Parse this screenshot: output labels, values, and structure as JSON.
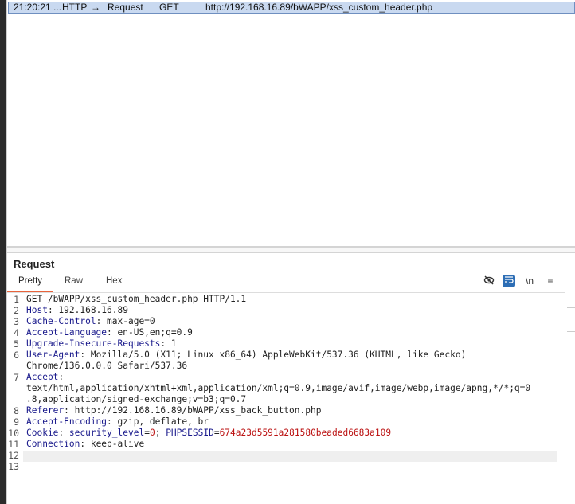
{
  "history": {
    "row": {
      "time": "21:20:21 ...",
      "tool": "HTTP",
      "direction": "→",
      "type": "Request",
      "method": "GET",
      "url": "http://192.168.16.89/bWAPP/xss_custom_header.php"
    }
  },
  "request": {
    "title": "Request",
    "tabs": [
      "Pretty",
      "Raw",
      "Hex"
    ],
    "active_tab": "Pretty",
    "toolbar": {
      "hide_icon": "eye-slash-icon",
      "wrap_icon": "wrap-lines-icon",
      "newline_label": "\\n",
      "menu_icon": "menu-icon"
    },
    "lines": [
      {
        "n": "1",
        "parts": [
          [
            "v",
            "GET /bWAPP/xss_custom_header.php HTTP/1.1"
          ]
        ]
      },
      {
        "n": "2",
        "parts": [
          [
            "k",
            "Host"
          ],
          [
            "v",
            ": 192.168.16.89"
          ]
        ]
      },
      {
        "n": "3",
        "parts": [
          [
            "k",
            "Cache-Control"
          ],
          [
            "v",
            ": max-age=0"
          ]
        ]
      },
      {
        "n": "4",
        "parts": [
          [
            "k",
            "Accept-Language"
          ],
          [
            "v",
            ": en-US,en;q=0.9"
          ]
        ]
      },
      {
        "n": "5",
        "parts": [
          [
            "k",
            "Upgrade-Insecure-Requests"
          ],
          [
            "v",
            ": 1"
          ]
        ]
      },
      {
        "n": "6",
        "parts": [
          [
            "k",
            "User-Agent"
          ],
          [
            "v",
            ": Mozilla/5.0 (X11; Linux x86_64) AppleWebKit/537.36 (KHTML, like Gecko)\nChrome/136.0.0.0 Safari/537.36"
          ]
        ]
      },
      {
        "n": "7",
        "parts": [
          [
            "k",
            "Accept"
          ],
          [
            "v",
            ":\ntext/html,application/xhtml+xml,application/xml;q=0.9,image/avif,image/webp,image/apng,*/*;q=0\n.8,application/signed-exchange;v=b3;q=0.7"
          ]
        ]
      },
      {
        "n": "8",
        "parts": [
          [
            "k",
            "Referer"
          ],
          [
            "v",
            ": http://192.168.16.89/bWAPP/xss_back_button.php"
          ]
        ]
      },
      {
        "n": "9",
        "parts": [
          [
            "k",
            "Accept-Encoding"
          ],
          [
            "v",
            ": gzip, deflate, br"
          ]
        ]
      },
      {
        "n": "10",
        "parts": [
          [
            "k",
            "Cookie"
          ],
          [
            "v",
            ": "
          ],
          [
            "k",
            "security_level"
          ],
          [
            "v",
            "="
          ],
          [
            "r",
            "0"
          ],
          [
            "v",
            "; "
          ],
          [
            "k",
            "PHPSESSID"
          ],
          [
            "v",
            "="
          ],
          [
            "r",
            "674a23d5591a281580beaded6683a109"
          ]
        ]
      },
      {
        "n": "11",
        "parts": [
          [
            "k",
            "Connection"
          ],
          [
            "v",
            ": keep-alive"
          ]
        ]
      },
      {
        "n": "12",
        "parts": []
      },
      {
        "n": "13",
        "parts": []
      }
    ]
  }
}
